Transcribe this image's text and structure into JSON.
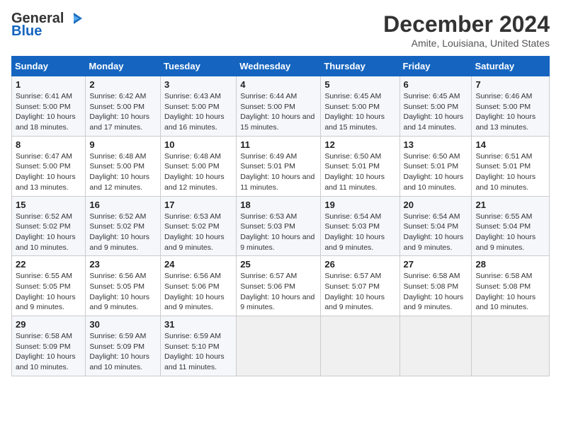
{
  "logo": {
    "line1": "General",
    "line2": "Blue"
  },
  "title": "December 2024",
  "subtitle": "Amite, Louisiana, United States",
  "columns": [
    "Sunday",
    "Monday",
    "Tuesday",
    "Wednesday",
    "Thursday",
    "Friday",
    "Saturday"
  ],
  "weeks": [
    [
      {
        "day": "1",
        "info": "Sunrise: 6:41 AM\nSunset: 5:00 PM\nDaylight: 10 hours and 18 minutes."
      },
      {
        "day": "2",
        "info": "Sunrise: 6:42 AM\nSunset: 5:00 PM\nDaylight: 10 hours and 17 minutes."
      },
      {
        "day": "3",
        "info": "Sunrise: 6:43 AM\nSunset: 5:00 PM\nDaylight: 10 hours and 16 minutes."
      },
      {
        "day": "4",
        "info": "Sunrise: 6:44 AM\nSunset: 5:00 PM\nDaylight: 10 hours and 15 minutes."
      },
      {
        "day": "5",
        "info": "Sunrise: 6:45 AM\nSunset: 5:00 PM\nDaylight: 10 hours and 15 minutes."
      },
      {
        "day": "6",
        "info": "Sunrise: 6:45 AM\nSunset: 5:00 PM\nDaylight: 10 hours and 14 minutes."
      },
      {
        "day": "7",
        "info": "Sunrise: 6:46 AM\nSunset: 5:00 PM\nDaylight: 10 hours and 13 minutes."
      }
    ],
    [
      {
        "day": "8",
        "info": "Sunrise: 6:47 AM\nSunset: 5:00 PM\nDaylight: 10 hours and 13 minutes."
      },
      {
        "day": "9",
        "info": "Sunrise: 6:48 AM\nSunset: 5:00 PM\nDaylight: 10 hours and 12 minutes."
      },
      {
        "day": "10",
        "info": "Sunrise: 6:48 AM\nSunset: 5:00 PM\nDaylight: 10 hours and 12 minutes."
      },
      {
        "day": "11",
        "info": "Sunrise: 6:49 AM\nSunset: 5:01 PM\nDaylight: 10 hours and 11 minutes."
      },
      {
        "day": "12",
        "info": "Sunrise: 6:50 AM\nSunset: 5:01 PM\nDaylight: 10 hours and 11 minutes."
      },
      {
        "day": "13",
        "info": "Sunrise: 6:50 AM\nSunset: 5:01 PM\nDaylight: 10 hours and 10 minutes."
      },
      {
        "day": "14",
        "info": "Sunrise: 6:51 AM\nSunset: 5:01 PM\nDaylight: 10 hours and 10 minutes."
      }
    ],
    [
      {
        "day": "15",
        "info": "Sunrise: 6:52 AM\nSunset: 5:02 PM\nDaylight: 10 hours and 10 minutes."
      },
      {
        "day": "16",
        "info": "Sunrise: 6:52 AM\nSunset: 5:02 PM\nDaylight: 10 hours and 9 minutes."
      },
      {
        "day": "17",
        "info": "Sunrise: 6:53 AM\nSunset: 5:02 PM\nDaylight: 10 hours and 9 minutes."
      },
      {
        "day": "18",
        "info": "Sunrise: 6:53 AM\nSunset: 5:03 PM\nDaylight: 10 hours and 9 minutes."
      },
      {
        "day": "19",
        "info": "Sunrise: 6:54 AM\nSunset: 5:03 PM\nDaylight: 10 hours and 9 minutes."
      },
      {
        "day": "20",
        "info": "Sunrise: 6:54 AM\nSunset: 5:04 PM\nDaylight: 10 hours and 9 minutes."
      },
      {
        "day": "21",
        "info": "Sunrise: 6:55 AM\nSunset: 5:04 PM\nDaylight: 10 hours and 9 minutes."
      }
    ],
    [
      {
        "day": "22",
        "info": "Sunrise: 6:55 AM\nSunset: 5:05 PM\nDaylight: 10 hours and 9 minutes."
      },
      {
        "day": "23",
        "info": "Sunrise: 6:56 AM\nSunset: 5:05 PM\nDaylight: 10 hours and 9 minutes."
      },
      {
        "day": "24",
        "info": "Sunrise: 6:56 AM\nSunset: 5:06 PM\nDaylight: 10 hours and 9 minutes."
      },
      {
        "day": "25",
        "info": "Sunrise: 6:57 AM\nSunset: 5:06 PM\nDaylight: 10 hours and 9 minutes."
      },
      {
        "day": "26",
        "info": "Sunrise: 6:57 AM\nSunset: 5:07 PM\nDaylight: 10 hours and 9 minutes."
      },
      {
        "day": "27",
        "info": "Sunrise: 6:58 AM\nSunset: 5:08 PM\nDaylight: 10 hours and 9 minutes."
      },
      {
        "day": "28",
        "info": "Sunrise: 6:58 AM\nSunset: 5:08 PM\nDaylight: 10 hours and 10 minutes."
      }
    ],
    [
      {
        "day": "29",
        "info": "Sunrise: 6:58 AM\nSunset: 5:09 PM\nDaylight: 10 hours and 10 minutes."
      },
      {
        "day": "30",
        "info": "Sunrise: 6:59 AM\nSunset: 5:09 PM\nDaylight: 10 hours and 10 minutes."
      },
      {
        "day": "31",
        "info": "Sunrise: 6:59 AM\nSunset: 5:10 PM\nDaylight: 10 hours and 11 minutes."
      },
      {
        "day": "",
        "info": ""
      },
      {
        "day": "",
        "info": ""
      },
      {
        "day": "",
        "info": ""
      },
      {
        "day": "",
        "info": ""
      }
    ]
  ]
}
